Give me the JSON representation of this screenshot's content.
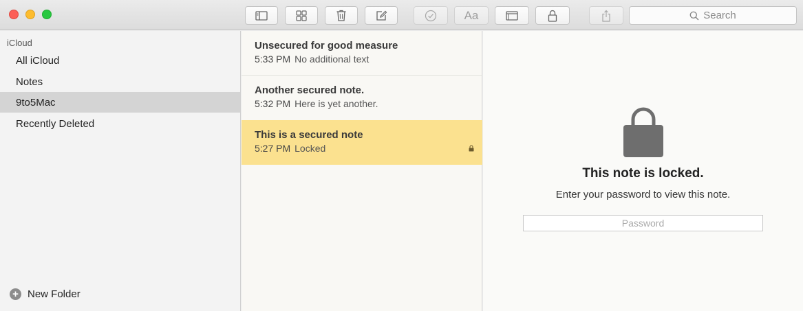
{
  "toolbar": {
    "search_label": "Search",
    "buttons": [
      {
        "icon": "sidebar-toggle-icon"
      },
      {
        "icon": "attachments-grid-icon"
      },
      {
        "icon": "trash-icon"
      },
      {
        "icon": "compose-icon"
      },
      {
        "icon": "checklist-icon"
      },
      {
        "icon": "text-format-icon",
        "label": "Aa"
      },
      {
        "icon": "window-icon"
      },
      {
        "icon": "lock-icon"
      },
      {
        "icon": "share-icon"
      }
    ]
  },
  "sidebar": {
    "header": "iCloud",
    "items": [
      {
        "label": "All iCloud"
      },
      {
        "label": "Notes"
      },
      {
        "label": "9to5Mac",
        "selected": true
      },
      {
        "label": "Recently Deleted"
      }
    ],
    "new_folder_label": "New Folder"
  },
  "notes": [
    {
      "title": "Unsecured for good measure",
      "time": "5:33 PM",
      "preview": "No additional text"
    },
    {
      "title": "Another secured note.",
      "time": "5:32 PM",
      "preview": "Here is yet another."
    },
    {
      "title": "This is a secured note",
      "time": "5:27 PM",
      "preview": "Locked",
      "selected": true,
      "locked": true
    }
  ],
  "detail": {
    "title": "This note is locked.",
    "subtitle": "Enter your password to view this note.",
    "password_placeholder": "Password"
  },
  "colors": {
    "selected_note": "#fbe18f",
    "selected_folder": "#d4d4d4",
    "lock_gray": "#6e6e6e"
  }
}
